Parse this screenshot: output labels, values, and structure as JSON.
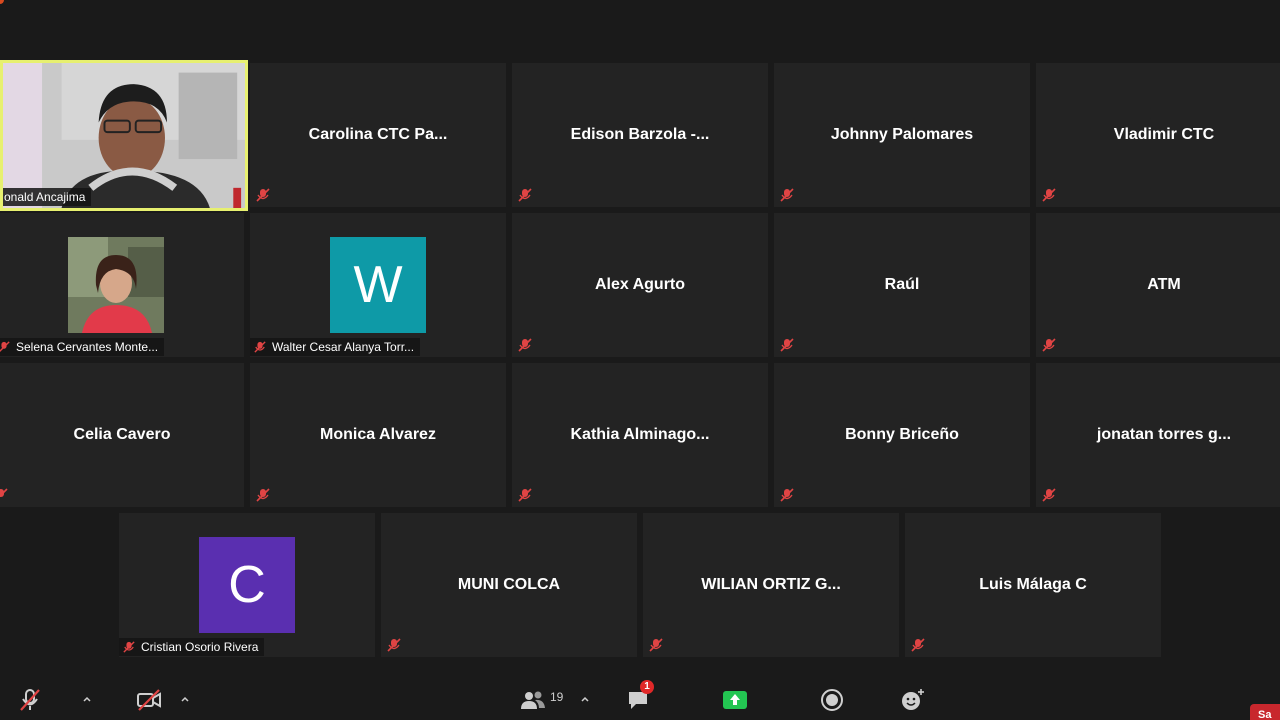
{
  "gallery": {
    "active_speaker": {
      "name": "onald Ancajima"
    },
    "row1": [
      {
        "name": "Carolina  CTC  Pa..."
      },
      {
        "name": "Edison  Barzola  -..."
      },
      {
        "name": "Johnny Palomares"
      },
      {
        "name": "Vladimir CTC"
      }
    ],
    "row2": [
      {
        "name": "Selena Cervantes Monte..."
      },
      {
        "name": "Walter Cesar Alanya Torr...",
        "avatar_letter": "W",
        "avatar_color": "#0e9aa7"
      },
      {
        "name": "Alex Agurto"
      },
      {
        "name": "Raúl"
      },
      {
        "name": "ATM"
      }
    ],
    "row3": [
      {
        "name": "Celia Cavero"
      },
      {
        "name": "Monica Alvarez"
      },
      {
        "name": "Kathia  Alminago..."
      },
      {
        "name": "Bonny Briceño"
      },
      {
        "name": "jonatan torres g..."
      }
    ],
    "row4": [
      {
        "name": "Cristian Osorio Rivera",
        "avatar_letter": "C",
        "avatar_color": "#5a2fb0"
      },
      {
        "name": "MUNI COLCA"
      },
      {
        "name": "WILIAN  ORTIZ  G..."
      },
      {
        "name": "Luis Málaga C"
      }
    ]
  },
  "toolbar": {
    "participants_count": "19",
    "chat_badge": "1",
    "end_label": "Sa",
    "icons": {
      "mute": "mic-muted-icon",
      "video": "video-off-icon",
      "participants": "participants-icon",
      "chat": "chat-icon",
      "share": "share-screen-icon",
      "record": "record-icon",
      "reactions": "reactions-icon"
    },
    "colors": {
      "share": "#23c552",
      "badge": "#e02828",
      "end": "#c8272d",
      "active_border": "#e7f070"
    }
  }
}
